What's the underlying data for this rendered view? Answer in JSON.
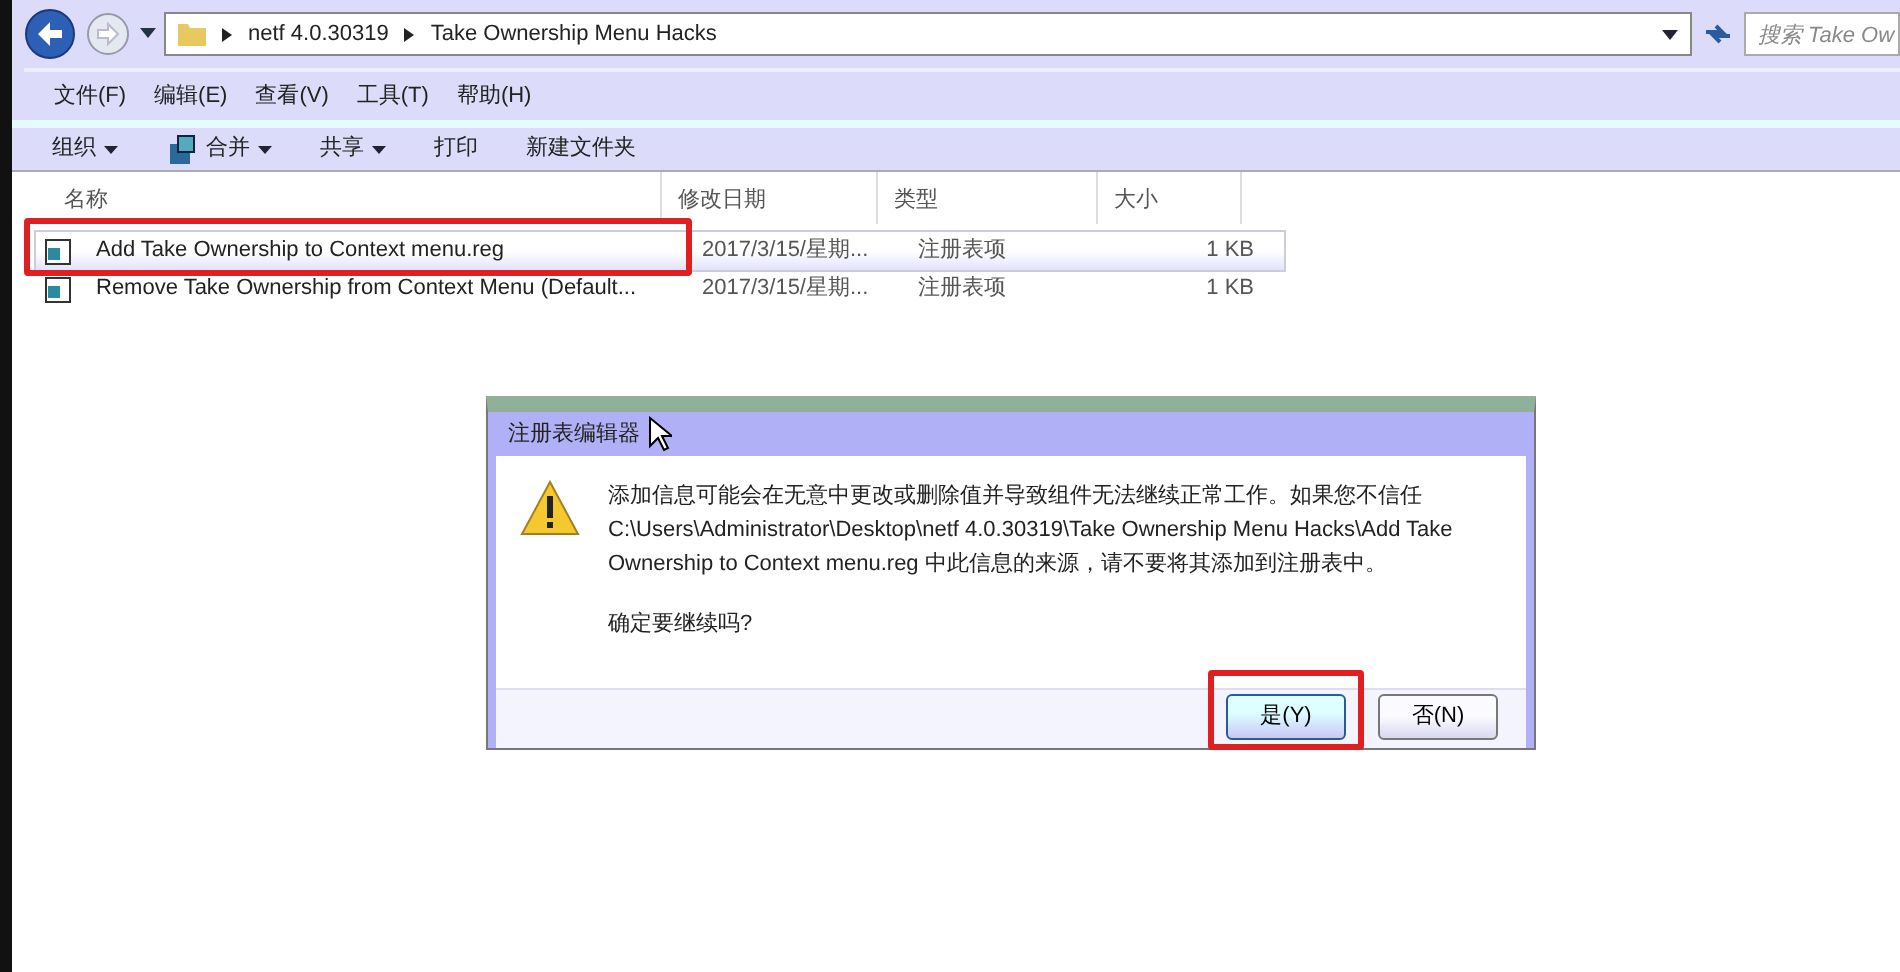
{
  "address_bar": {
    "segments": [
      "netf 4.0.30319",
      "Take Ownership Menu Hacks"
    ],
    "search_placeholder": "搜索 Take Ow"
  },
  "menu": [
    "文件(F)",
    "编辑(E)",
    "查看(V)",
    "工具(T)",
    "帮助(H)"
  ],
  "toolbar": [
    {
      "label": "组织",
      "kind": "dropdown"
    },
    {
      "label": "合并",
      "kind": "icon-dropdown"
    },
    {
      "label": "共享",
      "kind": "dropdown"
    },
    {
      "label": "打印",
      "kind": "plain"
    },
    {
      "label": "新建文件夹",
      "kind": "plain"
    }
  ],
  "table": {
    "columns": [
      "名称",
      "修改日期",
      "类型",
      "大小"
    ],
    "rows": [
      {
        "name": "Add Take Ownership to Context menu.reg",
        "date": "2017/3/15/星期...",
        "type": "注册表项",
        "size": "1 KB",
        "selected": true,
        "highlighted": true
      },
      {
        "name": "Remove Take Ownership from Context Menu (Default...",
        "date": "2017/3/15/星期...",
        "type": "注册表项",
        "size": "1 KB",
        "selected": false,
        "highlighted": false
      }
    ]
  },
  "dialog": {
    "title": "注册表编辑器",
    "message": "添加信息可能会在无意中更改或删除值并导致组件无法继续正常工作。如果您不信任 C:\\Users\\Administrator\\Desktop\\netf 4.0.30319\\Take Ownership Menu Hacks\\Add Take Ownership to Context menu.reg 中此信息的来源，请不要将其添加到注册表中。",
    "question": "确定要继续吗?",
    "buttons": [
      {
        "label": "是(Y)",
        "highlighted": true,
        "default": true
      },
      {
        "label": "否(N)",
        "highlighted": false,
        "default": false
      }
    ]
  }
}
